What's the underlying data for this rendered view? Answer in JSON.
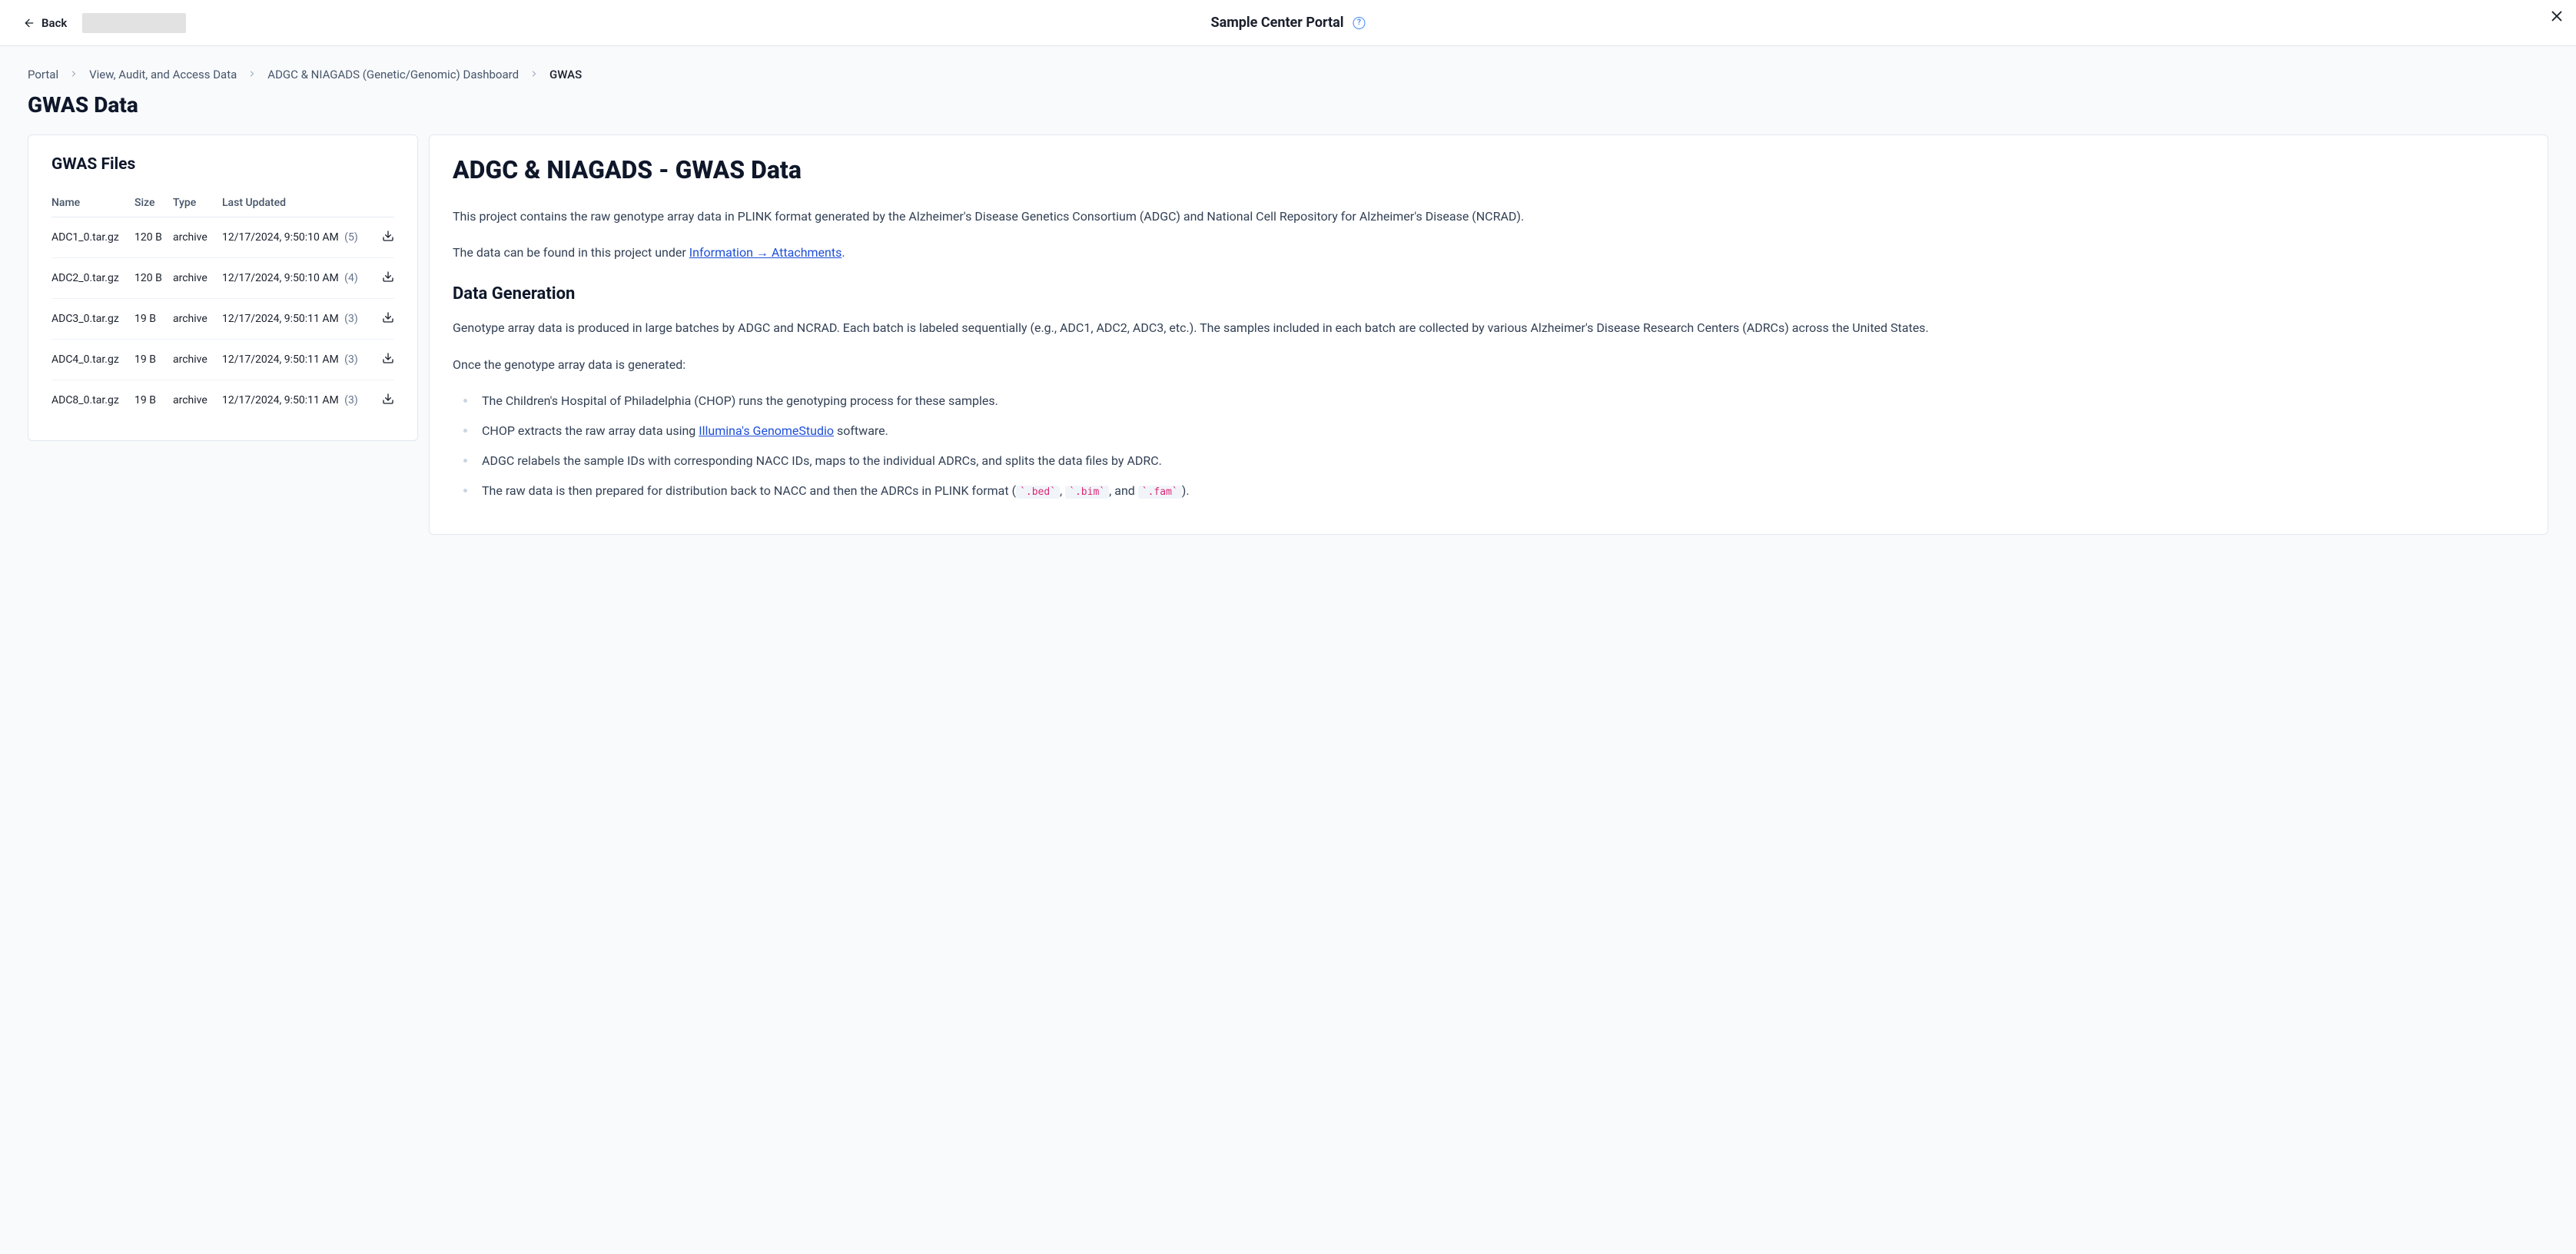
{
  "topbar": {
    "back_label": "Back",
    "title": "Sample Center Portal"
  },
  "breadcrumb": [
    {
      "label": "Portal",
      "current": false
    },
    {
      "label": "View, Audit, and Access Data",
      "current": false
    },
    {
      "label": "ADGC & NIAGADS (Genetic/Genomic) Dashboard",
      "current": false
    },
    {
      "label": "GWAS",
      "current": true
    }
  ],
  "page_title": "GWAS Data",
  "files_panel": {
    "heading": "GWAS Files",
    "columns": {
      "name": "Name",
      "size": "Size",
      "type": "Type",
      "updated": "Last Updated"
    },
    "rows": [
      {
        "name": "ADC1_0.tar.gz",
        "size": "120 B",
        "type": "archive",
        "updated": "12/17/2024, 9:50:10 AM",
        "rev": "(5)"
      },
      {
        "name": "ADC2_0.tar.gz",
        "size": "120 B",
        "type": "archive",
        "updated": "12/17/2024, 9:50:10 AM",
        "rev": "(4)"
      },
      {
        "name": "ADC3_0.tar.gz",
        "size": "19 B",
        "type": "archive",
        "updated": "12/17/2024, 9:50:11 AM",
        "rev": "(3)"
      },
      {
        "name": "ADC4_0.tar.gz",
        "size": "19 B",
        "type": "archive",
        "updated": "12/17/2024, 9:50:11 AM",
        "rev": "(3)"
      },
      {
        "name": "ADC8_0.tar.gz",
        "size": "19 B",
        "type": "archive",
        "updated": "12/17/2024, 9:50:11 AM",
        "rev": "(3)"
      }
    ]
  },
  "doc": {
    "title": "ADGC & NIAGADS - GWAS Data",
    "intro_p1": "This project contains the raw genotype array data in PLINK format generated by the Alzheimer's Disease Genetics Consortium (ADGC) and National Cell Repository for Alzheimer's Disease (NCRAD).",
    "intro_p2_prefix": "The data can be found in this project under ",
    "intro_p2_link": "Information → Attachments",
    "intro_p2_suffix": ".",
    "h2_datagen": "Data Generation",
    "datagen_p1": "Genotype array data is produced in large batches by ADGC and NCRAD. Each batch is labeled sequentially (e.g., ADC1, ADC2, ADC3, etc.). The samples included in each batch are collected by various Alzheimer's Disease Research Centers (ADRCs) across the United States.",
    "datagen_p2": "Once the genotype array data is generated:",
    "bullets": {
      "b1": "The Children's Hospital of Philadelphia (CHOP) runs the genotyping process for these samples.",
      "b2_prefix": "CHOP extracts the raw array data using ",
      "b2_link": "Illumina's GenomeStudio",
      "b2_suffix": " software.",
      "b3": "ADGC relabels the sample IDs with corresponding NACC IDs, maps to the individual ADRCs, and splits the data files by ADRC.",
      "b4_prefix": "The raw data is then prepared for distribution back to NACC and then the ADRCs in PLINK format (",
      "b4_code1": "`.bed`",
      "b4_mid1": ", ",
      "b4_code2": "`.bim`",
      "b4_mid2": ", and ",
      "b4_code3": "`.fam`",
      "b4_suffix": ")."
    }
  }
}
